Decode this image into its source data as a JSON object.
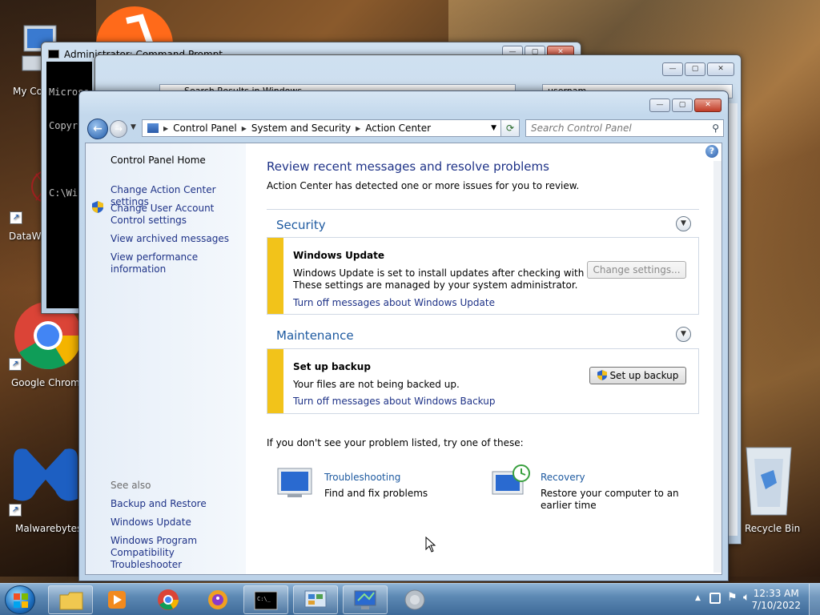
{
  "desktop": {
    "icons": [
      {
        "label": "My Co"
      },
      {
        "label": "DataWa"
      },
      {
        "label": "Google Chrome"
      },
      {
        "label": "Malwarebytes"
      },
      {
        "label": "Recycle Bin"
      }
    ]
  },
  "bg_windows": {
    "cmd_title": "Administrator: Command Prompt",
    "cmd_lines": [
      "Microso",
      "Copyrig",
      "",
      "C:\\Wi"
    ],
    "explorer_address": "Search Results in Windows",
    "explorer_search_value": "usernam"
  },
  "window": {
    "breadcrumb": [
      "Control Panel",
      "System and Security",
      "Action Center"
    ],
    "search_placeholder": "Search Control Panel",
    "help": "?"
  },
  "left_pane": {
    "home": "Control Panel Home",
    "links": [
      "Change Action Center settings",
      "Change User Account Control settings",
      "View archived messages",
      "View performance information"
    ],
    "see_also_label": "See also",
    "see_also": [
      "Backup and Restore",
      "Windows Update",
      "Windows Program Compatibility Troubleshooter"
    ]
  },
  "main": {
    "heading": "Review recent messages and resolve problems",
    "subheading": "Action Center has detected one or more issues for you to review.",
    "security": {
      "title": "Security",
      "msg_title": "Windows Update",
      "msg_line1": "Windows Update is set to install updates after checking with you.",
      "msg_line2": "These settings are managed by your system administrator.",
      "msg_link": "Turn off messages about Windows Update",
      "button": "Change settings..."
    },
    "maintenance": {
      "title": "Maintenance",
      "msg_title": "Set up backup",
      "msg_text": "Your files are not being backed up.",
      "msg_link": "Turn off messages about Windows Backup",
      "button": "Set up backup"
    },
    "footer_text": "If you don't see your problem listed, try one of these:",
    "troubleshooting": {
      "title": "Troubleshooting",
      "text": "Find and fix problems"
    },
    "recovery": {
      "title": "Recovery",
      "text1": "Restore your computer to an",
      "text2": "earlier time"
    }
  },
  "taskbar": {
    "time": "12:33 AM",
    "date": "7/10/2022"
  },
  "colors": {
    "link": "#1e3287",
    "section_title": "#1e5aa0",
    "warning_bar": "#f2c31a"
  }
}
